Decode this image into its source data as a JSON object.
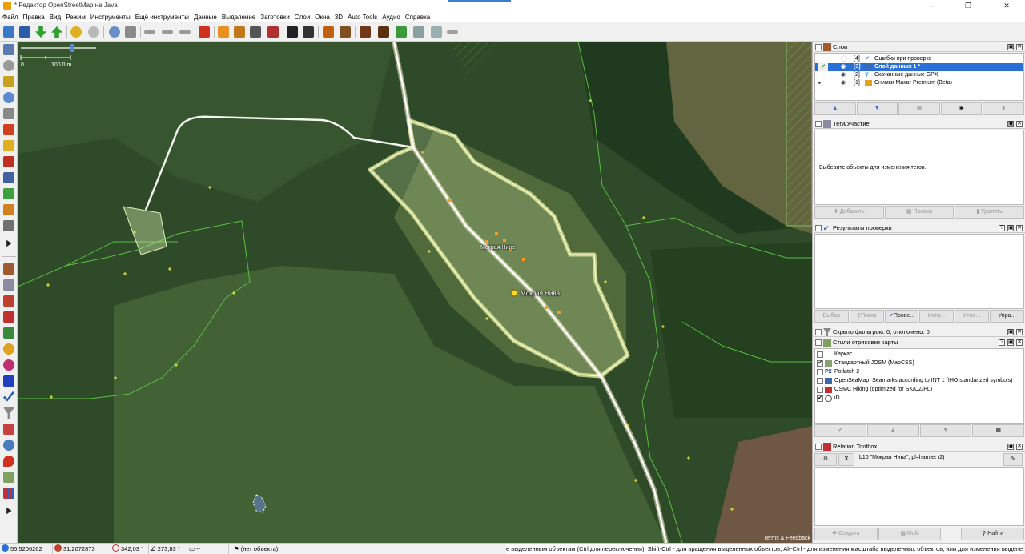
{
  "window": {
    "title": "* Редактор OpenStreetMap на Java",
    "minimize": "–",
    "maximize": "❐",
    "close": "✕"
  },
  "menu": [
    "Файл",
    "Правка",
    "Вид",
    "Режим",
    "Инструменты",
    "Ещё инструменты",
    "Данные",
    "Выделение",
    "Заготовки",
    "Слои",
    "Окна",
    "3D",
    "Auto Tools",
    "Аудио",
    "Справка"
  ],
  "map": {
    "scale_left": "0",
    "scale_right": "100.0 m",
    "labels": {
      "place_small": "Мокрая Нива",
      "place_main": "Мокрая Нива"
    },
    "attribution": "Terms & Feedback"
  },
  "panels": {
    "layers": {
      "title": "Слои",
      "items": [
        {
          "index": "[4]",
          "name": "Ошибки при проверке"
        },
        {
          "index": "[3]",
          "name": "Слой данных 1 *"
        },
        {
          "index": "[2]",
          "name": "Скачанные данные GPX"
        },
        {
          "index": "[1]",
          "name": "Снимки Maxar Premium (Beta)"
        }
      ]
    },
    "tags": {
      "title": "Теги/Участие",
      "hint": "Выберите объекты для изменения тегов.",
      "buttons": [
        "Добавить",
        "Правка",
        "Удалить"
      ]
    },
    "validation": {
      "title": "Результаты проверки",
      "buttons": [
        "Выбор",
        "Поиск",
        "Прове...",
        "Испр...",
        "Игно...",
        "Упра..."
      ]
    },
    "filter": {
      "title": "Скрыто фильтром: 0, отключено: 0"
    },
    "styles": {
      "title": "Стили отрисовки карты",
      "items": [
        {
          "name": "Каркас",
          "checked": false
        },
        {
          "name": "Стандартный JOSM (MapCSS)",
          "checked": true
        },
        {
          "name": "Potlatch 2",
          "checked": false
        },
        {
          "name": "OpenSeaMap: Seamarks according to INT 1 (IHO standarized symbols)",
          "checked": false
        },
        {
          "name": "OSMC Hiking (optimized for SK/CZ/PL)",
          "checked": false
        },
        {
          "name": "iD",
          "checked": true
        }
      ]
    },
    "relation": {
      "title": "Relation Toolbox",
      "x_button": "X",
      "relation_text": "b10 \"Мокрая Нива\"; pl=hamlet (2)",
      "buttons": [
        "Создать",
        "Multi",
        "Найти"
      ]
    }
  },
  "status": {
    "lat": "55.5206262",
    "lon": "31.2072873",
    "heading": "342,03 °",
    "angle": "273,83 °",
    "length": "--",
    "object": "(нет объекта)",
    "help": "е выделенным объектам (Ctrl для переключения); Shift-Ctrl - для вращения выделенных объектов; Alt-Ctrl - для изменения масштаба выделенных объектов; или для изменения выделения"
  },
  "colors": {
    "accent": "#2a6fd6",
    "forest": "#2f4a28",
    "field": "#6e7a4a",
    "road": "#f2f2e8",
    "area_highlight": "#d8e888"
  }
}
